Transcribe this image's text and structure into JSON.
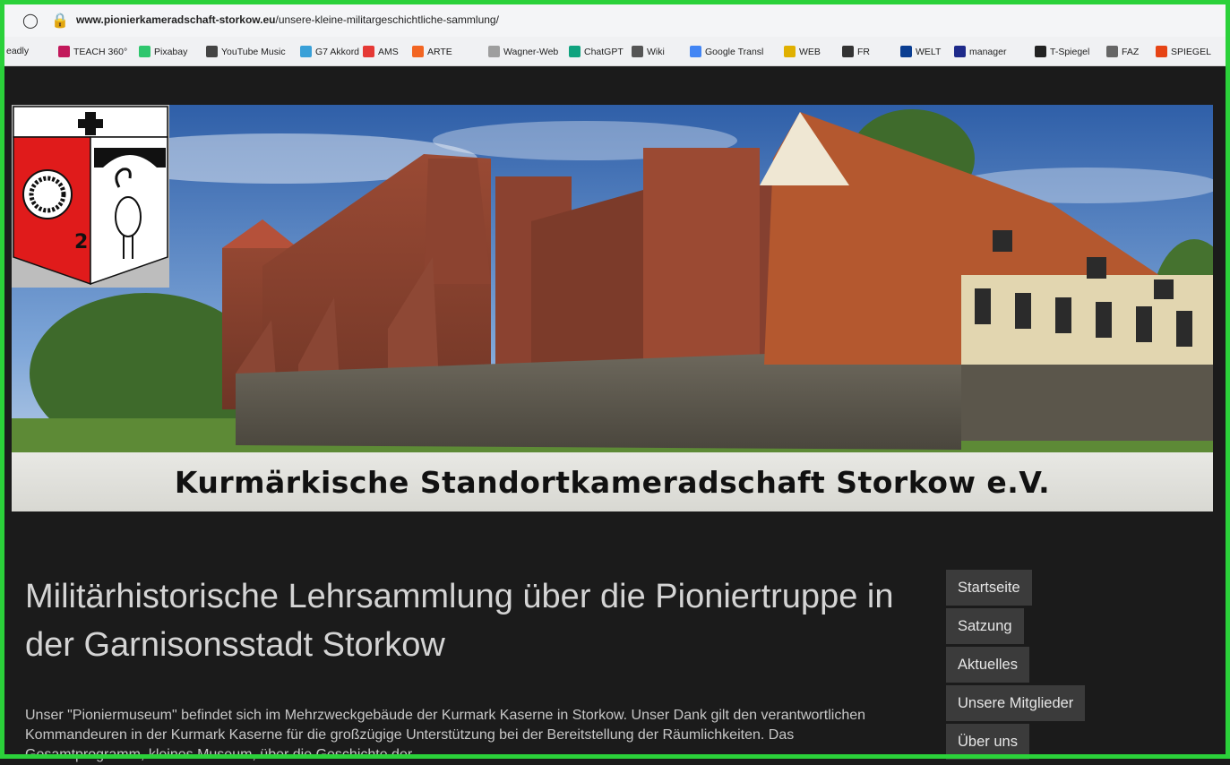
{
  "browser": {
    "url_domain": "www.pionierkameradschaft-storkow.eu",
    "url_path": "/unsere-kleine-militargeschichtliche-sammlung/",
    "bookmarks": [
      {
        "label": "eadly",
        "color": "#6b6b6b"
      },
      {
        "label": "TEACH 360°",
        "color": "#c2185b"
      },
      {
        "label": "Pixabay",
        "color": "#2ec66d"
      },
      {
        "label": "YouTube Music",
        "color": "#444444"
      },
      {
        "label": "G7 Akkord",
        "color": "#39a0d8"
      },
      {
        "label": "AMS",
        "color": "#e53935"
      },
      {
        "label": "ARTE",
        "color": "#f26522"
      },
      {
        "label": "Wagner-Web",
        "color": "#9e9e9e"
      },
      {
        "label": "ChatGPT",
        "color": "#10a37f"
      },
      {
        "label": "Wiki",
        "color": "#555555"
      },
      {
        "label": "Google Transl",
        "color": "#4285f4"
      },
      {
        "label": "WEB",
        "color": "#e0b000"
      },
      {
        "label": "FR",
        "color": "#333333"
      },
      {
        "label": "WELT",
        "color": "#0a3d91"
      },
      {
        "label": "manager",
        "color": "#1e2a8a"
      },
      {
        "label": "T-Spiegel",
        "color": "#222222"
      },
      {
        "label": "FAZ",
        "color": "#666666"
      },
      {
        "label": "SPIEGEL",
        "color": "#e64415"
      }
    ]
  },
  "site": {
    "title": "Kurmärkische Standortkameradschaft Storkow e.V.",
    "crest_number": "2"
  },
  "main": {
    "heading": "Militärhistorische Lehrsammlung über die Pioniertruppe in der Garnisonsstadt Storkow",
    "body": "Unser \"Pioniermuseum\" befindet sich im Mehrzweckgebäude der Kurmark Kaserne in Storkow. Unser Dank gilt den verantwortlichen Kommandeuren in der Kurmark Kaserne für die großzügige Unterstützung bei der Bereitstellung der Räumlichkeiten. Das Gesamtprogramm, kleines Museum, über die Geschichte der"
  },
  "nav": {
    "items": [
      "Startseite",
      "Satzung",
      "Aktuelles",
      "Unsere Mitglieder",
      "Über uns"
    ]
  },
  "colors": {
    "page_bg": "#1b1b1b",
    "nav_bg": "#3b3b3b",
    "highlight_border": "#2bd13a"
  }
}
